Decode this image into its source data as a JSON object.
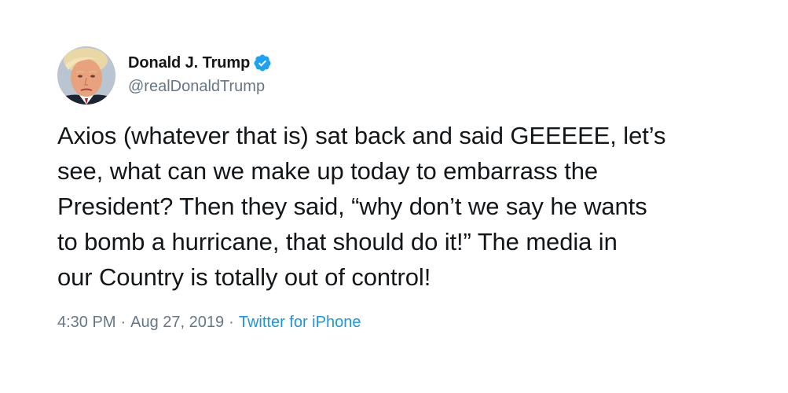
{
  "tweet": {
    "author": {
      "display_name": "Donald J. Trump",
      "handle": "@realDonaldTrump",
      "verified_icon": "verified-badge-icon",
      "avatar_icon": "profile-avatar"
    },
    "text": "Axios (whatever that is) sat back and said GEEEEE, let’s\nsee, what can we make up today to embarrass the\nPresident? Then they said, “why don’t we say he wants\nto bomb a hurricane, that should do it!” The media in\nour Country is totally out of control!",
    "time": "4:30 PM",
    "separator_1": "·",
    "date": "Aug 27, 2019",
    "separator_2": "·",
    "source": "Twitter for iPhone"
  },
  "colors": {
    "text_primary": "#14171a",
    "text_secondary": "#657786",
    "link": "#1b95e0",
    "verified": "#1da1f2"
  }
}
